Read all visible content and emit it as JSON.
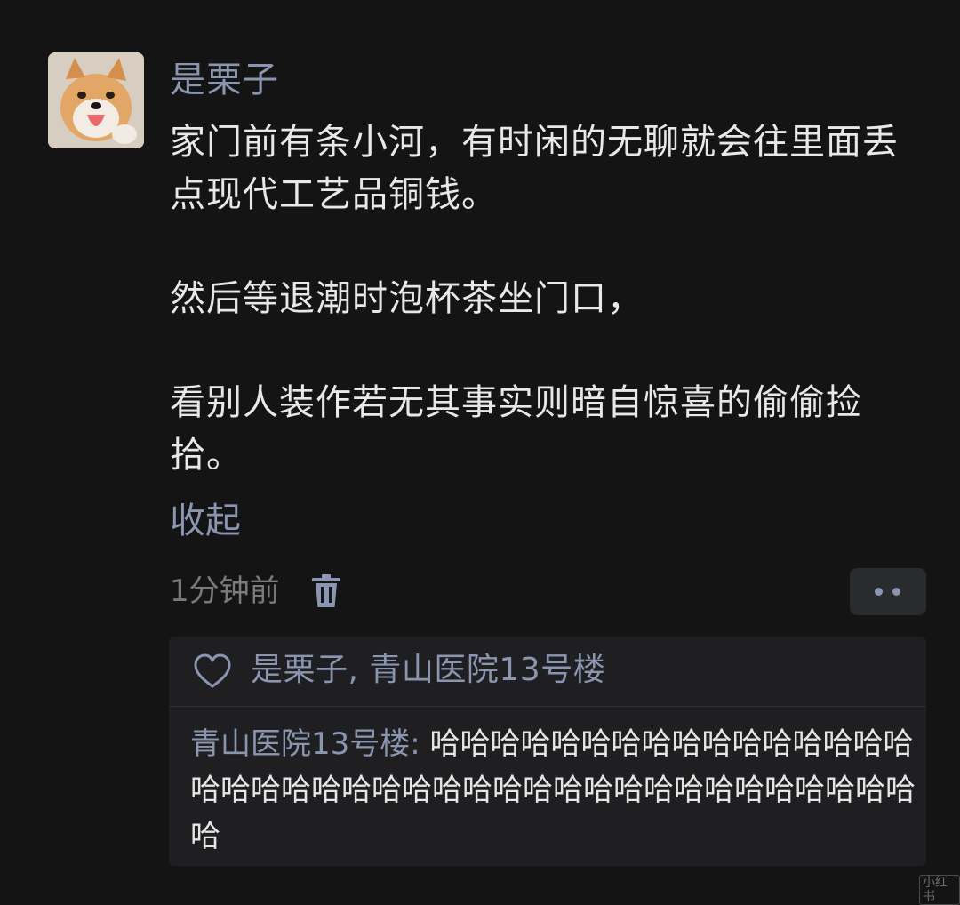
{
  "post": {
    "username": "是栗子",
    "paragraphs": [
      "家门前有条小河，有时闲的无聊就会往里面丢点现代工艺品铜钱。",
      "然后等退潮时泡杯茶坐门口，",
      "看别人装作若无其事实则暗自惊喜的偷偷捡拾。"
    ],
    "collapse_label": "收起",
    "time": "1分钟前",
    "icons": {
      "avatar": "shiba-dog-avatar",
      "delete": "trash-icon",
      "more": "more-dots-icon"
    }
  },
  "interactions": {
    "likes": "是栗子, 青山医院13号楼",
    "like_icon": "heart-icon",
    "comments": [
      {
        "author": "青山医院13号楼",
        "separator": ": ",
        "text": "哈哈哈哈哈哈哈哈哈哈哈哈哈哈哈哈哈哈哈哈哈哈哈哈哈哈哈哈哈哈哈哈哈哈哈哈哈哈哈哈哈"
      }
    ]
  },
  "watermark": "小红书",
  "colors": {
    "background": "#141414",
    "link": "#8a95b0",
    "text": "#e8e8e8",
    "muted": "#7a7a7a",
    "panel": "#1f1f21"
  }
}
